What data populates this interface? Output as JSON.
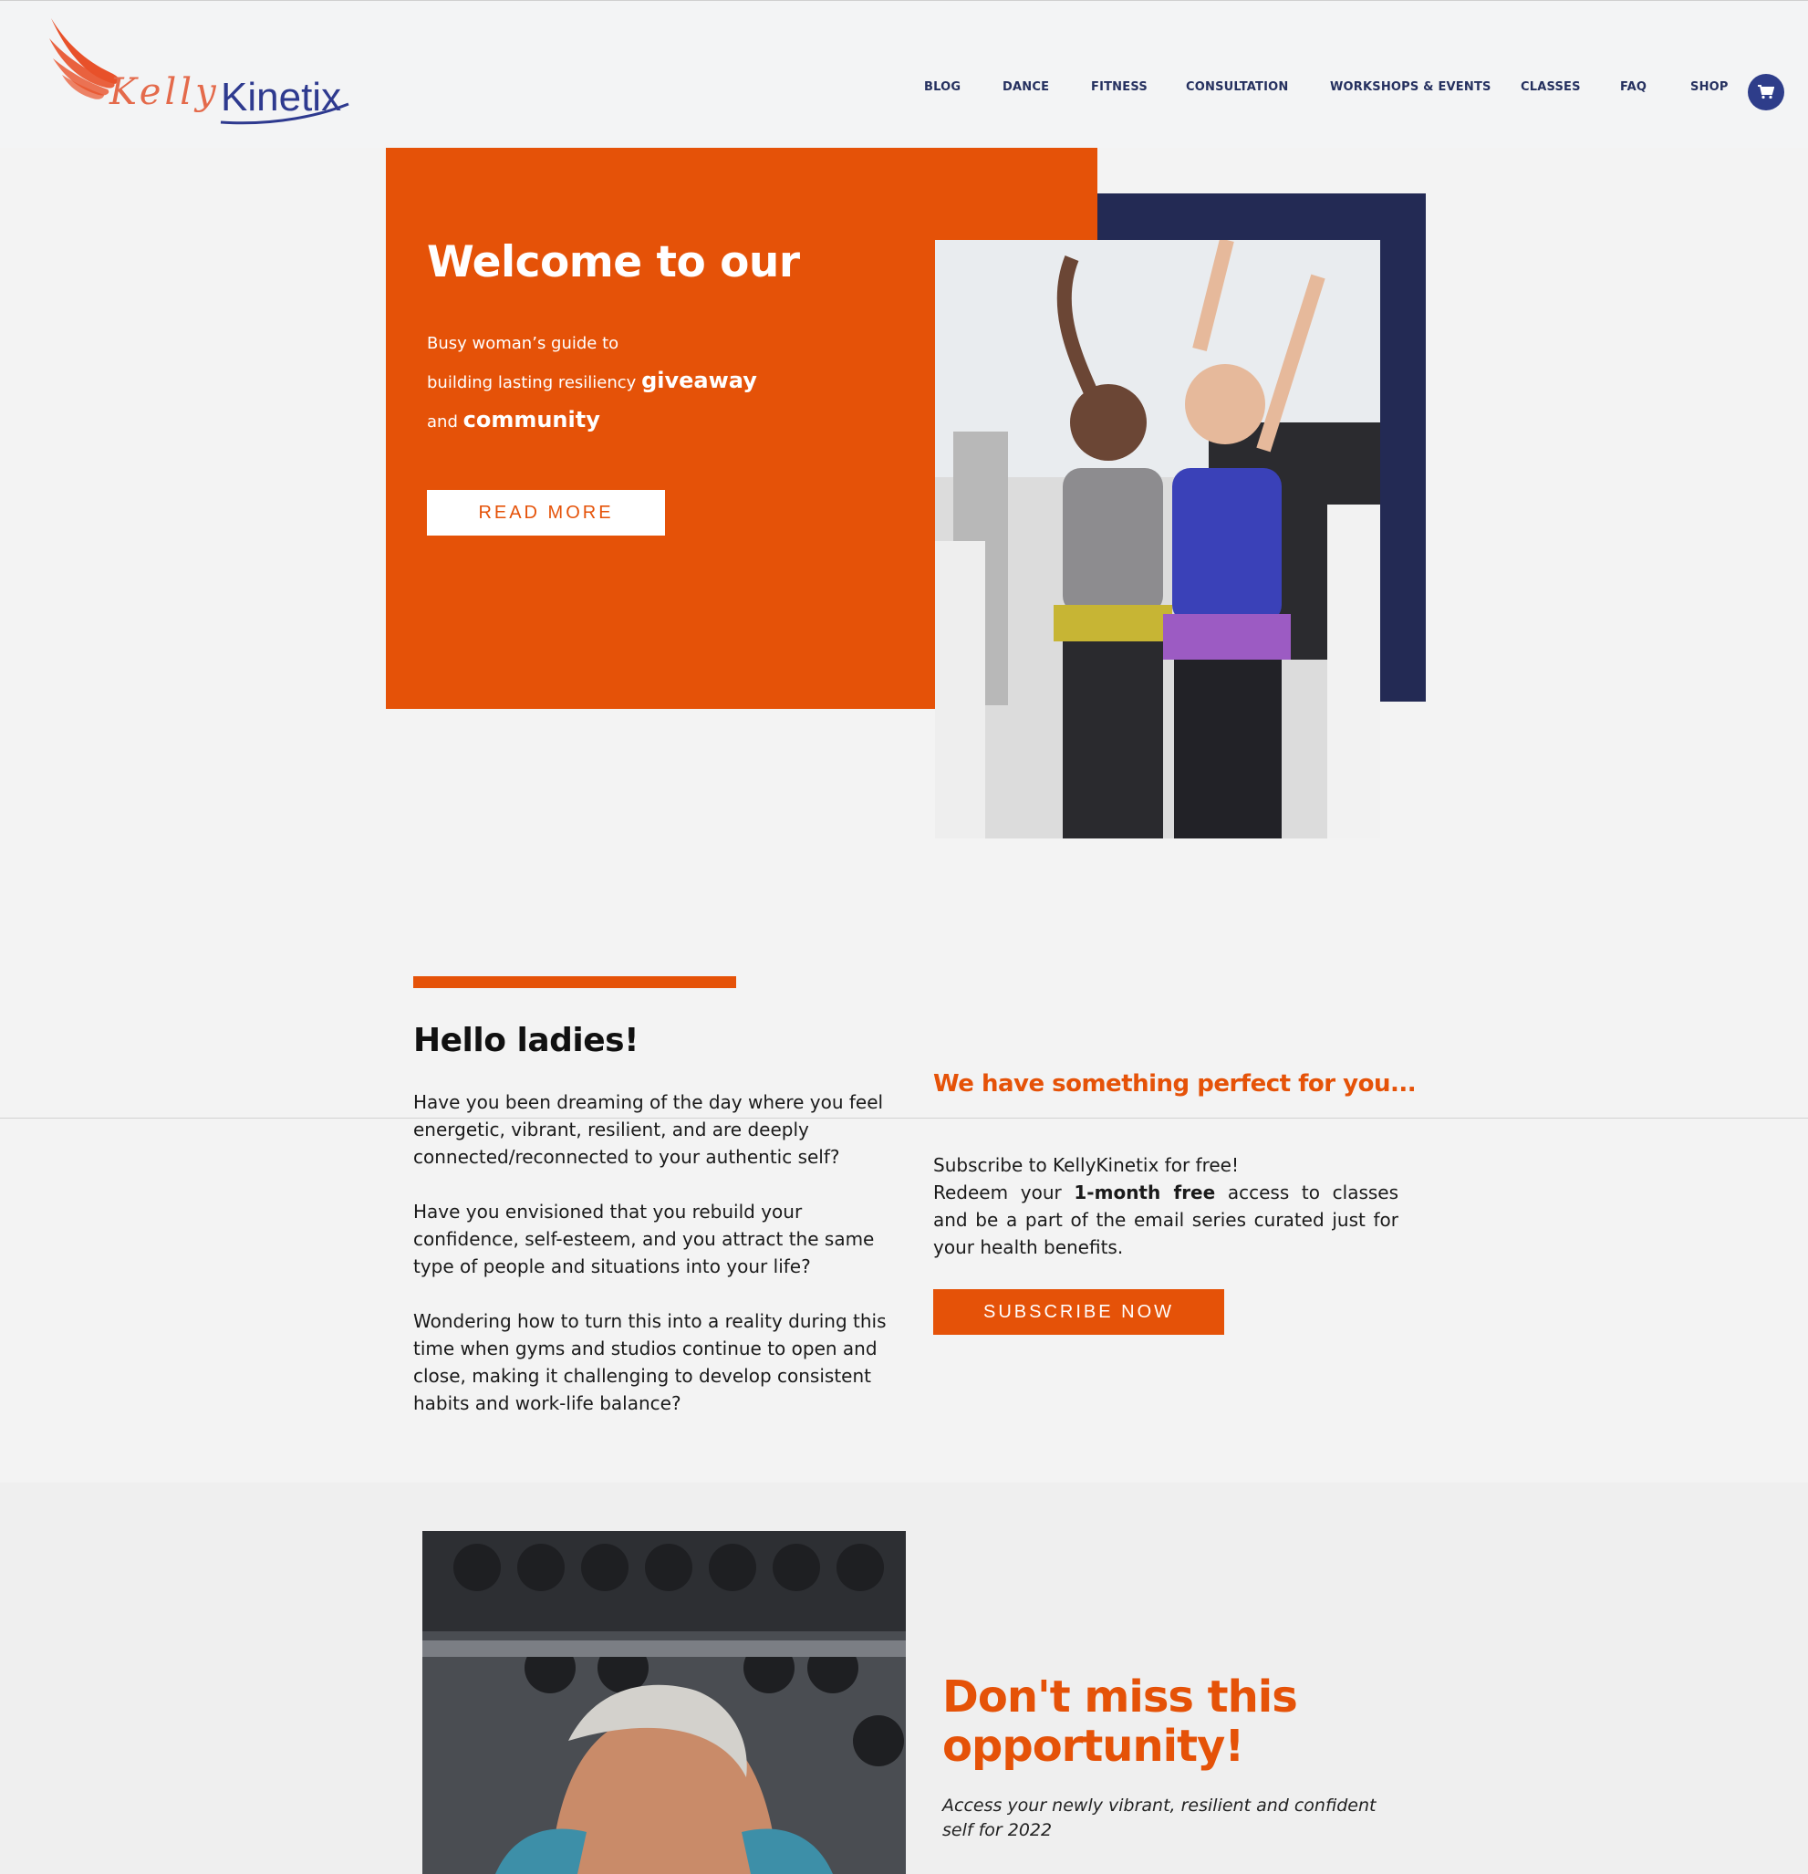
{
  "header": {
    "logo_text_kelly": "Kelly",
    "logo_text_kinetix": "Kinetix",
    "nav": [
      {
        "label": "BLOG"
      },
      {
        "label": "DANCE"
      },
      {
        "label": "FITNESS"
      },
      {
        "label": "CONSULTATION"
      },
      {
        "label": "WORKSHOPS & EVENTS"
      },
      {
        "label": "CLASSES"
      },
      {
        "label": "FAQ"
      },
      {
        "label": "SHOP"
      }
    ],
    "cart_icon": "shopping-cart-icon"
  },
  "hero": {
    "title": "Welcome to our",
    "line1": "Busy woman’s guide to",
    "line2": "building lasting resiliency",
    "line2_bold": "giveaway",
    "line3": "and",
    "line3_bold": "community",
    "button_label": "READ MORE"
  },
  "hello": {
    "title": "Hello ladies!",
    "paragraphs": [
      "Have you been dreaming of the day where you feel energetic, vibrant, resilient, and are deeply connected/reconnected to your authentic self?",
      "Have you envisioned that you rebuild your confidence, self-esteem, and you attract the same type of people and situations into your life?",
      "Wondering how to turn this into a reality during this time when gyms and studios continue to open and close, making it challenging to develop consistent habits and work-life balance?"
    ]
  },
  "offer": {
    "title": "We have something perfect for you...",
    "line1": "Subscribe to KellyKinetix for free!",
    "line2_a": "Redeem your",
    "line2_bold": "1-month free",
    "line2_b": "access to classes and be a part of the email series curated just for your health benefits.",
    "button_label": "SUBSCRIBE NOW"
  },
  "promo": {
    "title": "Don't miss this opportunity!",
    "subtitle": "Access your newly vibrant, resilient and confident self for 2022"
  },
  "colors": {
    "accent_orange": "#e55208",
    "navy": "#232a54",
    "nav_text": "#25305f",
    "cart_blue": "#2e3d8a"
  }
}
